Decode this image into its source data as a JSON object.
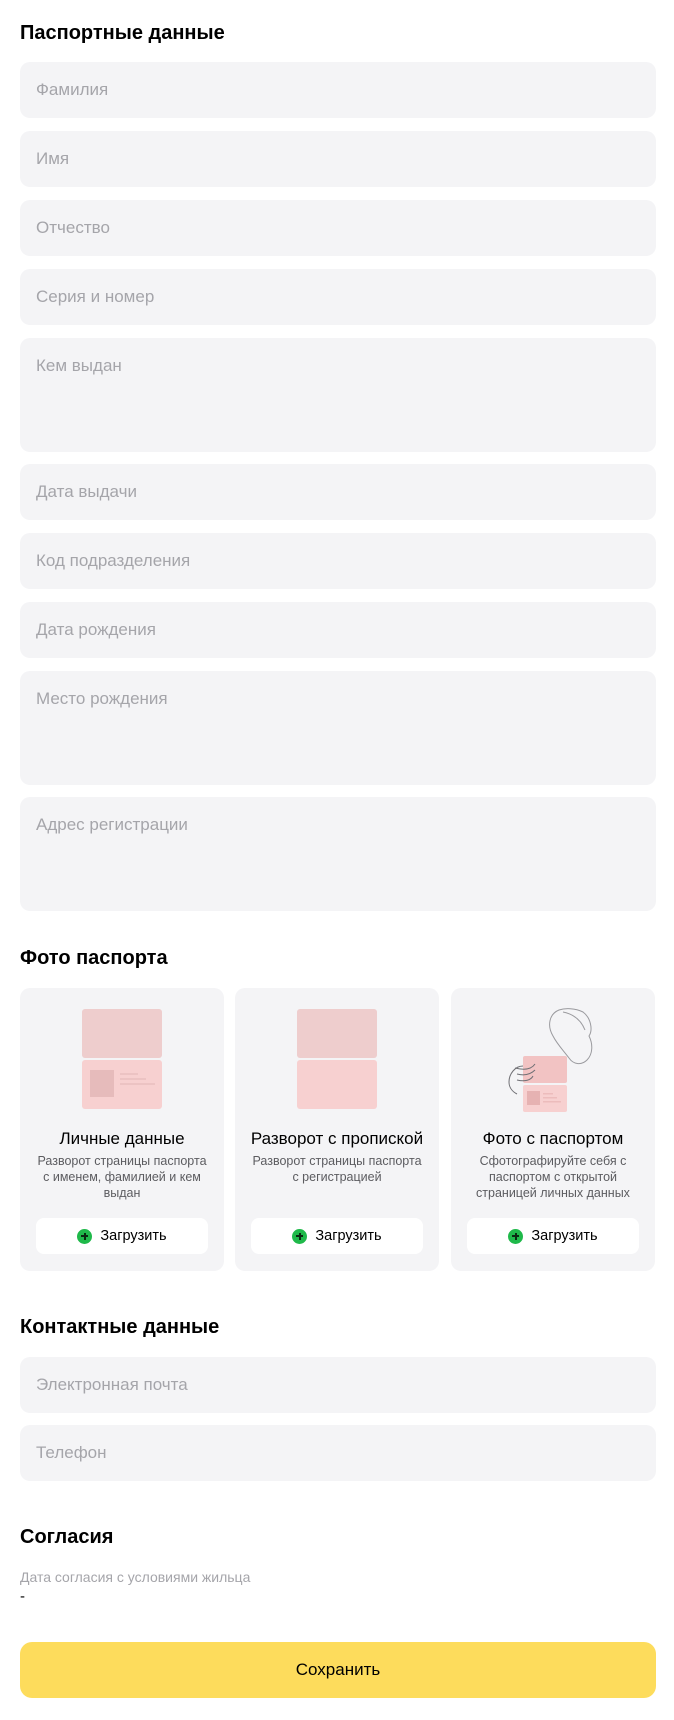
{
  "passport": {
    "title": "Паспортные данные",
    "fields": {
      "last_name": "Фамилия",
      "first_name": "Имя",
      "patronymic": "Отчество",
      "series_number": "Серия и номер",
      "issued_by": "Кем выдан",
      "issue_date": "Дата выдачи",
      "division_code": "Код подразделения",
      "birth_date": "Дата рождения",
      "birth_place": "Место рождения",
      "registration_address": "Адрес регистрации"
    }
  },
  "photos": {
    "title": "Фото паспорта",
    "cards": [
      {
        "title": "Личные данные",
        "description": "Разворот страницы паспорта с именем, фамилией и кем выдан",
        "button": "Загрузить",
        "icon": "passport-personal-page-icon"
      },
      {
        "title": "Разворот с пропиской",
        "description": "Разворот страницы паспорта с регистрацией",
        "button": "Загрузить",
        "icon": "passport-registration-page-icon"
      },
      {
        "title": "Фото с паспортом",
        "description": "Сфотографируйте себя с паспортом с открытой страницей личных данных",
        "button": "Загрузить",
        "icon": "selfie-with-passport-icon"
      }
    ],
    "accent_color": "#1fb94a"
  },
  "contacts": {
    "title": "Контактные данные",
    "fields": {
      "email": "Электронная почта",
      "phone": "Телефон"
    }
  },
  "consents": {
    "title": "Согласия",
    "label": "Дата согласия с условиями жильца",
    "value": "-"
  },
  "save_button": {
    "label": "Сохранить",
    "color": "#fddc5c"
  }
}
